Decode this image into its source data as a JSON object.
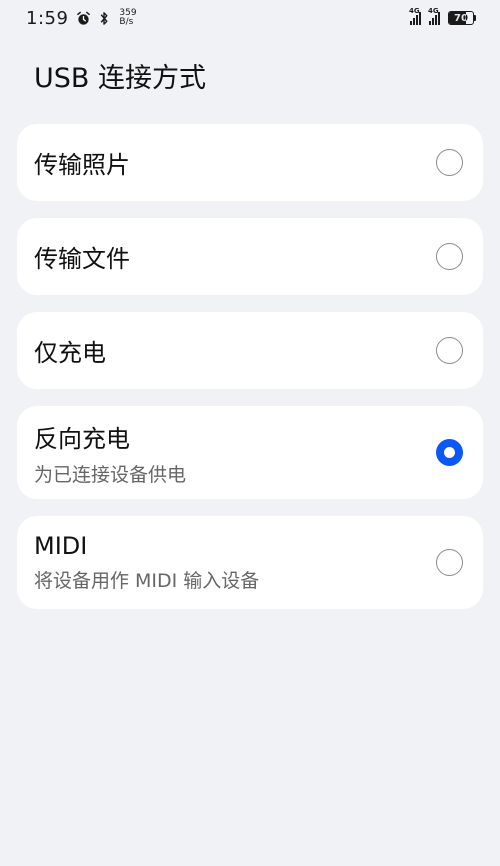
{
  "status_bar": {
    "time": "1:59",
    "net_speed_value": "359",
    "net_speed_unit": "B/s",
    "signal_1_gen": "4G",
    "signal_2_gen": "4G",
    "battery_level": "70",
    "icons": [
      "alarm-icon",
      "bluetooth-icon",
      "signal-icon",
      "battery-icon"
    ]
  },
  "page": {
    "title": "USB 连接方式"
  },
  "options": [
    {
      "label": "传输照片",
      "sublabel": "",
      "selected": false
    },
    {
      "label": "传输文件",
      "sublabel": "",
      "selected": false
    },
    {
      "label": "仅充电",
      "sublabel": "",
      "selected": false
    },
    {
      "label": "反向充电",
      "sublabel": "为已连接设备供电",
      "selected": true
    },
    {
      "label": "MIDI",
      "sublabel": "将设备用作 MIDI 输入设备",
      "selected": false
    }
  ],
  "colors": {
    "accent": "#0a59f7",
    "background": "#f1f2f6",
    "card": "#ffffff"
  }
}
